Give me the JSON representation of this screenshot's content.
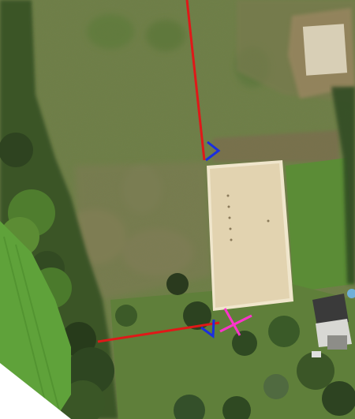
{
  "map": {
    "kind": "aerial-photo",
    "colors": {
      "field_grass": "#6f7f4a",
      "field_dark": "#5f6f3c",
      "arena_sand": "#e2d3b0",
      "arena_border": "#f0e6cc",
      "hedge_trees": "#2f4a22",
      "bright_field": "#5fa23a",
      "roof": "#3a3a3a",
      "red_line": "#e01818",
      "blue_marker": "#1a2ee0",
      "magenta_marker": "#ff33cc"
    }
  },
  "overlays": {
    "red_lines": 2,
    "blue_chevrons": 2,
    "magenta_cross": 1
  }
}
